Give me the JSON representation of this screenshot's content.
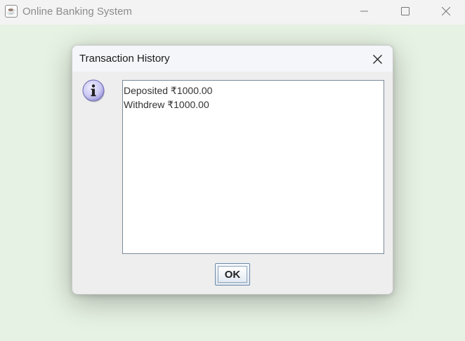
{
  "window": {
    "title": "Online Banking System",
    "app_icon": "java-cup-icon",
    "controls": [
      "minimize-icon",
      "maximize-icon",
      "close-icon"
    ]
  },
  "dialog": {
    "title": "Transaction History",
    "message_icon": "info-icon",
    "history_lines": [
      "Deposited ₹1000.00",
      "Withdrew ₹1000.00"
    ],
    "ok_label": "OK"
  },
  "colors": {
    "desktop_background": "#e6f2e3",
    "titlebar": "#f3f3f3",
    "dialog_background": "#eeeeee",
    "text_area_border": "#7a8a99",
    "info_icon_fill": "#c9c6f2"
  }
}
